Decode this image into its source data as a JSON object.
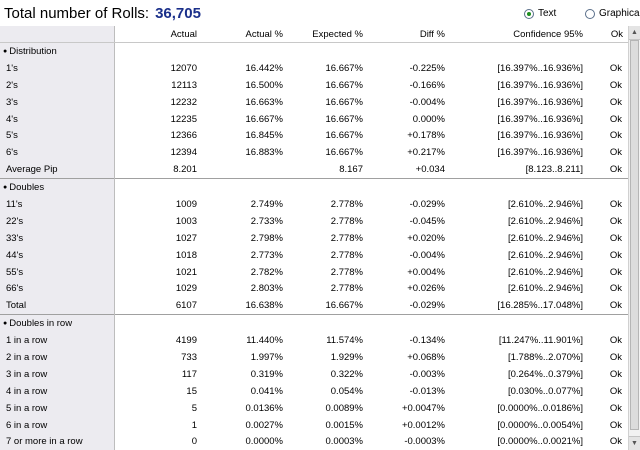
{
  "header": {
    "title": "Total number of Rolls:",
    "total": "36,705",
    "view_options": [
      {
        "label": "Text",
        "selected": true
      },
      {
        "label": "Graphical",
        "selected": false
      }
    ]
  },
  "columns": [
    "",
    "Actual",
    "Actual %",
    "Expected %",
    "Diff %",
    "Confidence 95%",
    "Ok"
  ],
  "sections": [
    {
      "title": "Distribution",
      "rows": [
        [
          "1's",
          "12070",
          "16.442%",
          "16.667%",
          "-0.225%",
          "[16.397%..16.936%]",
          "Ok"
        ],
        [
          "2's",
          "12113",
          "16.500%",
          "16.667%",
          "-0.166%",
          "[16.397%..16.936%]",
          "Ok"
        ],
        [
          "3's",
          "12232",
          "16.663%",
          "16.667%",
          "-0.004%",
          "[16.397%..16.936%]",
          "Ok"
        ],
        [
          "4's",
          "12235",
          "16.667%",
          "16.667%",
          "0.000%",
          "[16.397%..16.936%]",
          "Ok"
        ],
        [
          "5's",
          "12366",
          "16.845%",
          "16.667%",
          "+0.178%",
          "[16.397%..16.936%]",
          "Ok"
        ],
        [
          "6's",
          "12394",
          "16.883%",
          "16.667%",
          "+0.217%",
          "[16.397%..16.936%]",
          "Ok"
        ],
        [
          "Average Pip",
          "8.201",
          "",
          "8.167",
          "+0.034",
          "[8.123..8.211]",
          "Ok"
        ]
      ]
    },
    {
      "title": "Doubles",
      "rows": [
        [
          "11's",
          "1009",
          "2.749%",
          "2.778%",
          "-0.029%",
          "[2.610%..2.946%]",
          "Ok"
        ],
        [
          "22's",
          "1003",
          "2.733%",
          "2.778%",
          "-0.045%",
          "[2.610%..2.946%]",
          "Ok"
        ],
        [
          "33's",
          "1027",
          "2.798%",
          "2.778%",
          "+0.020%",
          "[2.610%..2.946%]",
          "Ok"
        ],
        [
          "44's",
          "1018",
          "2.773%",
          "2.778%",
          "-0.004%",
          "[2.610%..2.946%]",
          "Ok"
        ],
        [
          "55's",
          "1021",
          "2.782%",
          "2.778%",
          "+0.004%",
          "[2.610%..2.946%]",
          "Ok"
        ],
        [
          "66's",
          "1029",
          "2.803%",
          "2.778%",
          "+0.026%",
          "[2.610%..2.946%]",
          "Ok"
        ],
        [
          "Total",
          "6107",
          "16.638%",
          "16.667%",
          "-0.029%",
          "[16.285%..17.048%]",
          "Ok"
        ]
      ]
    },
    {
      "title": "Doubles in row",
      "rows": [
        [
          "1 in a row",
          "4199",
          "11.440%",
          "11.574%",
          "-0.134%",
          "[11.247%..11.901%]",
          "Ok"
        ],
        [
          "2 in a row",
          "733",
          "1.997%",
          "1.929%",
          "+0.068%",
          "[1.788%..2.070%]",
          "Ok"
        ],
        [
          "3 in a row",
          "117",
          "0.319%",
          "0.322%",
          "-0.003%",
          "[0.264%..0.379%]",
          "Ok"
        ],
        [
          "4 in a row",
          "15",
          "0.041%",
          "0.054%",
          "-0.013%",
          "[0.030%..0.077%]",
          "Ok"
        ],
        [
          "5 in a row",
          "5",
          "0.0136%",
          "0.0089%",
          "+0.0047%",
          "[0.0000%..0.0186%]",
          "Ok"
        ],
        [
          "6 in a row",
          "1",
          "0.0027%",
          "0.0015%",
          "+0.0012%",
          "[0.0000%..0.0054%]",
          "Ok"
        ],
        [
          "7 or more in a row",
          "0",
          "0.0000%",
          "0.0003%",
          "-0.0003%",
          "[0.0000%..0.0021%]",
          "Ok"
        ]
      ]
    }
  ],
  "icons": {
    "bullet": "bullet-icon",
    "scroll_up": "scroll-up-arrow-icon",
    "scroll_down": "scroll-down-arrow-icon"
  },
  "colors": {
    "total": "#1a2f8a",
    "radio_selected": "#1f8f1f",
    "label_column_bg": "#ecebf0"
  }
}
